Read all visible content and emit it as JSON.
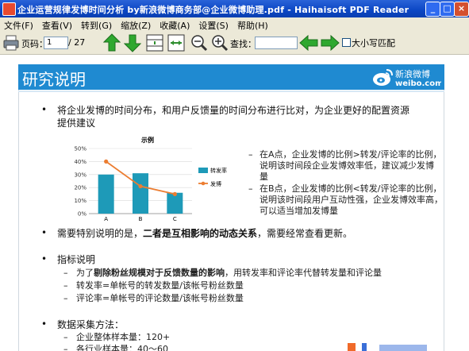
{
  "window": {
    "title": "企业运营规律发博时间分析 by新浪微博商务部@企业微博助理.pdf - Haihaisoft PDF Reader"
  },
  "menu": [
    "文件(F)",
    "查看(V)",
    "转到(G)",
    "缩放(Z)",
    "收藏(A)",
    "设置(S)",
    "帮助(H)"
  ],
  "toolbar": {
    "page_label": "页码：",
    "page_value": "1",
    "page_total": "/ 27",
    "search_label": "查找：",
    "match_case_label": "大小写匹配"
  },
  "slide": {
    "title": "研究说明",
    "logo_text": "新浪微博",
    "logo_url": "weibo.com",
    "para1_line1": "将企业发博的时间分布，和用户反馈量的时间分布进行比对，为企业更好的配置资源",
    "para1_line2": "提供建议",
    "note_a_1": "在A点，企业发博的比例>转发/评论率的比例，",
    "note_a_2": "说明该时间段企业发博效率低，建议减少发博",
    "note_a_3": "量",
    "note_b_1": "在B点，企业发博的比例<转发/评论率的比例，",
    "note_b_2": "说明该时间段用户互动性强，企业发博效率高，",
    "note_b_3": "可以适当增加发博量",
    "para2_prefix": "需要特别说明的是，",
    "para2_bold": "二者是互相影响的动态关系",
    "para2_suffix": "，需要经常查看更新。",
    "para3": "指标说明",
    "sub1_prefix": "为了",
    "sub1_bold": "剔除粉丝规模对于反馈数量的影响",
    "sub1_suffix": "，用转发率和评论率代替转发量和评论量",
    "sub2": "转发率=单帐号的转发数量/该帐号粉丝数量",
    "sub3": "评论率=单帐号的评论数量/该帐号粉丝数量",
    "para4": "数据采集方法：",
    "sub4": "企业整体样本量：120+",
    "sub5": "各行业样本量：40～60"
  },
  "chart_data": {
    "type": "bar",
    "title": "示例",
    "categories": [
      "A",
      "B",
      "C"
    ],
    "ylim": [
      0,
      50
    ],
    "yticks": [
      "0%",
      "10%",
      "20%",
      "30%",
      "40%",
      "50%"
    ],
    "series": [
      {
        "name": "转发率",
        "kind": "bar",
        "values": [
          30,
          31,
          16
        ],
        "color": "#1e9ab8"
      },
      {
        "name": "发博",
        "kind": "line",
        "values": [
          40,
          21,
          15
        ],
        "color": "#ec7d31"
      }
    ]
  },
  "colors": {
    "header_blue": "#1f8ad1",
    "arrow_green": "#2fa82f"
  }
}
